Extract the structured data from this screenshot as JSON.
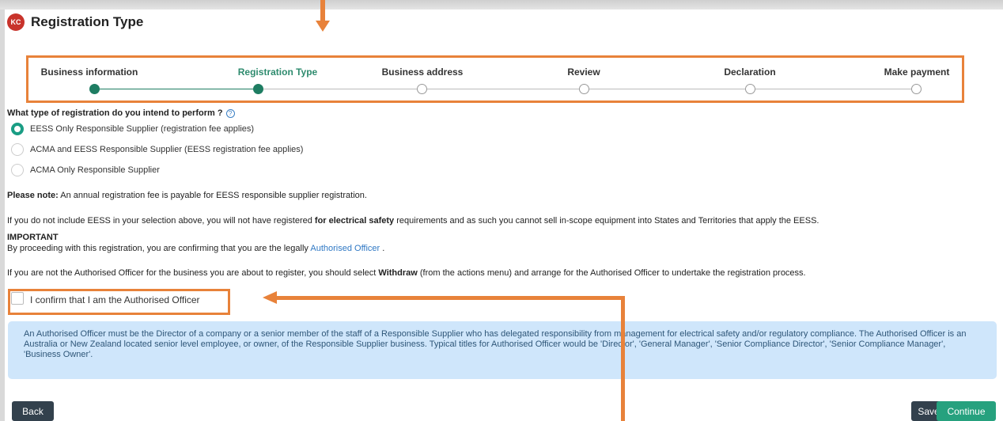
{
  "header": {
    "avatar_initials": "KC",
    "title": "Registration Type"
  },
  "stepper": {
    "steps": [
      {
        "label": "Business information",
        "state": "done"
      },
      {
        "label": "Registration Type",
        "state": "active"
      },
      {
        "label": "Business address",
        "state": "todo"
      },
      {
        "label": "Review",
        "state": "todo"
      },
      {
        "label": "Declaration",
        "state": "todo"
      },
      {
        "label": "Make payment",
        "state": "todo"
      }
    ]
  },
  "question": {
    "text": "What type of registration do you intend to perform ?",
    "help_icon": "question-circle-icon"
  },
  "options": [
    {
      "label": "EESS Only Responsible Supplier (registration fee applies)",
      "checked": true
    },
    {
      "label": "ACMA and EESS Responsible Supplier (EESS registration fee applies)",
      "checked": false
    },
    {
      "label": "ACMA Only Responsible Supplier",
      "checked": false
    }
  ],
  "note": {
    "label": "Please note:",
    "text": " An annual registration fee is payable for EESS responsible supplier registration."
  },
  "eess_warning": {
    "pre": "If you do not include EESS in your selection above, you will not have registered ",
    "bold": "for electrical safety",
    "post": " requirements and as such you cannot sell in-scope equipment into States and Territories that apply the EESS."
  },
  "important": {
    "heading": "IMPORTANT",
    "pre": "By proceeding with this registration, you are confirming that you are the legally ",
    "link": "Authorised Officer",
    "post": " ."
  },
  "withdraw": {
    "pre": "If you are not the Authorised Officer for the business you are about to register, you should select ",
    "bold": "Withdraw",
    "post": " (from the actions menu) and arrange for the Authorised Officer to undertake the registration process."
  },
  "confirm": {
    "label": "I confirm that I am the Authorised Officer",
    "checked": false
  },
  "info": {
    "text": "An Authorised Officer must be the Director of a company or a senior member of the staff of a Responsible Supplier who has delegated responsibility from management for electrical safety and/or regulatory compliance. The Authorised Officer is an Australia or New Zealand located senior level employee, or owner, of the Responsible Supplier business. Typical titles for Authorised Officer would be 'Director', 'General Manager', 'Senior Compliance Director', 'Senior Compliance Manager', 'Business Owner'."
  },
  "buttons": {
    "back": "Back",
    "save": "Save",
    "continue": "Continue"
  },
  "colors": {
    "annotation": "#e8823a",
    "primary": "#26a17e",
    "dark": "#33414d"
  }
}
